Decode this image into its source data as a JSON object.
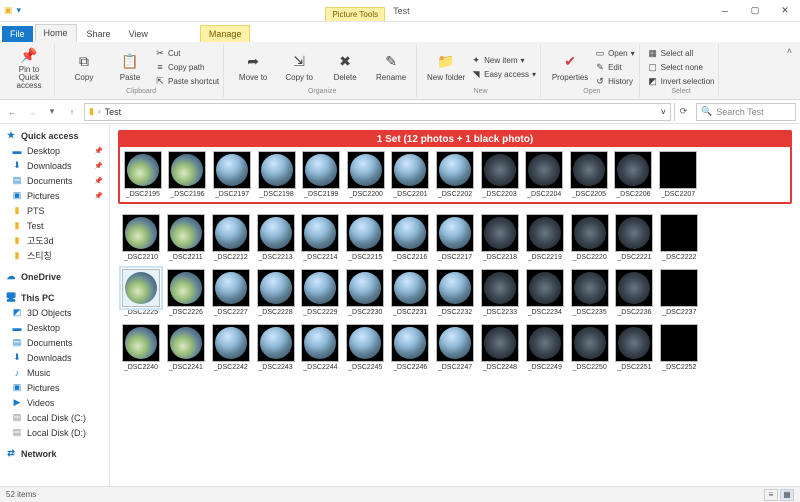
{
  "window": {
    "tool_context": "Picture Tools",
    "title": "Test"
  },
  "tabs": {
    "file": "File",
    "home": "Home",
    "share": "Share",
    "view": "View",
    "manage": "Manage"
  },
  "ribbon": {
    "pin": "Pin to Quick access",
    "copy": "Copy",
    "paste": "Paste",
    "cut": "Cut",
    "copy_path": "Copy path",
    "paste_shortcut": "Paste shortcut",
    "clipboard": "Clipboard",
    "move_to": "Move to",
    "copy_to": "Copy to",
    "delete": "Delete",
    "rename": "Rename",
    "organize": "Organize",
    "new_folder": "New folder",
    "new_item": "New item",
    "easy_access": "Easy access",
    "new": "New",
    "properties": "Properties",
    "open": "Open",
    "edit": "Edit",
    "history": "History",
    "open_group": "Open",
    "select_all": "Select all",
    "select_none": "Select none",
    "invert": "Invert selection",
    "select": "Select"
  },
  "breadcrumb": {
    "seg1": "Test"
  },
  "search": {
    "placeholder": "Search Test"
  },
  "sidebar": {
    "quick_access": "Quick access",
    "desktop": "Desktop",
    "downloads": "Downloads",
    "documents": "Documents",
    "pictures": "Pictures",
    "pts": "PTS",
    "test": "Test",
    "k1": "고도3d",
    "k2": "스티칭",
    "onedrive": "OneDrive",
    "thispc": "This PC",
    "objects3d": "3D Objects",
    "desktop2": "Desktop",
    "documents2": "Documents",
    "downloads2": "Downloads",
    "music": "Music",
    "pictures2": "Pictures",
    "videos": "Videos",
    "localc": "Local Disk (C:)",
    "locald": "Local Disk (D:)",
    "network": "Network"
  },
  "annotation": "1 Set (12 photos + 1 black photo)",
  "files": {
    "row1": [
      "_DSC2195",
      "_DSC2196",
      "_DSC2197",
      "_DSC2198",
      "_DSC2199",
      "_DSC2200",
      "_DSC2201",
      "_DSC2202",
      "_DSC2203",
      "_DSC2204",
      "_DSC2205",
      "_DSC2206",
      "_DSC2207"
    ],
    "row2": [
      "_DSC2210",
      "_DSC2211",
      "_DSC2212",
      "_DSC2213",
      "_DSC2214",
      "_DSC2215",
      "_DSC2216",
      "_DSC2217",
      "_DSC2218",
      "_DSC2219",
      "_DSC2220",
      "_DSC2221",
      "_DSC2222"
    ],
    "row3": [
      "_DSC2225",
      "_DSC2226",
      "_DSC2227",
      "_DSC2228",
      "_DSC2229",
      "_DSC2230",
      "_DSC2231",
      "_DSC2232",
      "_DSC2233",
      "_DSC2234",
      "_DSC2235",
      "_DSC2236",
      "_DSC2237"
    ],
    "row4": [
      "_DSC2240",
      "_DSC2241",
      "_DSC2242",
      "_DSC2243",
      "_DSC2244",
      "_DSC2245",
      "_DSC2246",
      "_DSC2247",
      "_DSC2248",
      "_DSC2249",
      "_DSC2250",
      "_DSC2251",
      "_DSC2252"
    ]
  },
  "status": {
    "count": "52 items"
  }
}
